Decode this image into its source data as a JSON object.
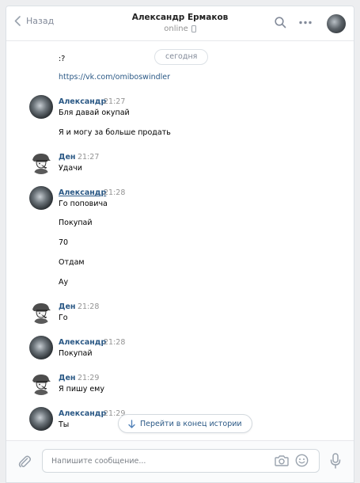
{
  "header": {
    "back_label": "Назад",
    "title": "Александр Ермаков",
    "status": "online"
  },
  "messages": {
    "date_pill": "сегодня",
    "lines": [
      ":?",
      "https://vk.com/omiboswindler"
    ],
    "groups": [
      {
        "author": "Александр",
        "time": "21:27",
        "texts": [
          "Бля давай окупай",
          "Я и могу за больше продать"
        ]
      },
      {
        "author": "Ден",
        "time": "21:27",
        "texts": [
          "Удачи"
        ]
      },
      {
        "author": "Александр",
        "time": "21:28",
        "texts": [
          "Го поповича",
          "Покупай",
          "70",
          "Отдам",
          "Ау"
        ]
      },
      {
        "author": "Ден",
        "time": "21:28",
        "texts": [
          "Го"
        ]
      },
      {
        "author": "Александр",
        "time": "21:28",
        "texts": [
          "Покупай"
        ]
      },
      {
        "author": "Ден",
        "time": "21:29",
        "texts": [
          "Я пишу ему"
        ]
      },
      {
        "author": "Александр",
        "time": "21:29",
        "texts": [
          "Ты"
        ]
      }
    ],
    "jump_label": "Перейти в конец истории"
  },
  "composer": {
    "placeholder": "Напишите сообщение..."
  },
  "icons": [
    "chevron-left-icon",
    "phone-icon",
    "search-icon",
    "more-icon",
    "arrow-down-icon",
    "paperclip-icon",
    "camera-icon",
    "smile-icon",
    "microphone-icon"
  ],
  "colors": {
    "link": "#2a5885",
    "meta": "#939393",
    "background": "#edeef0"
  }
}
